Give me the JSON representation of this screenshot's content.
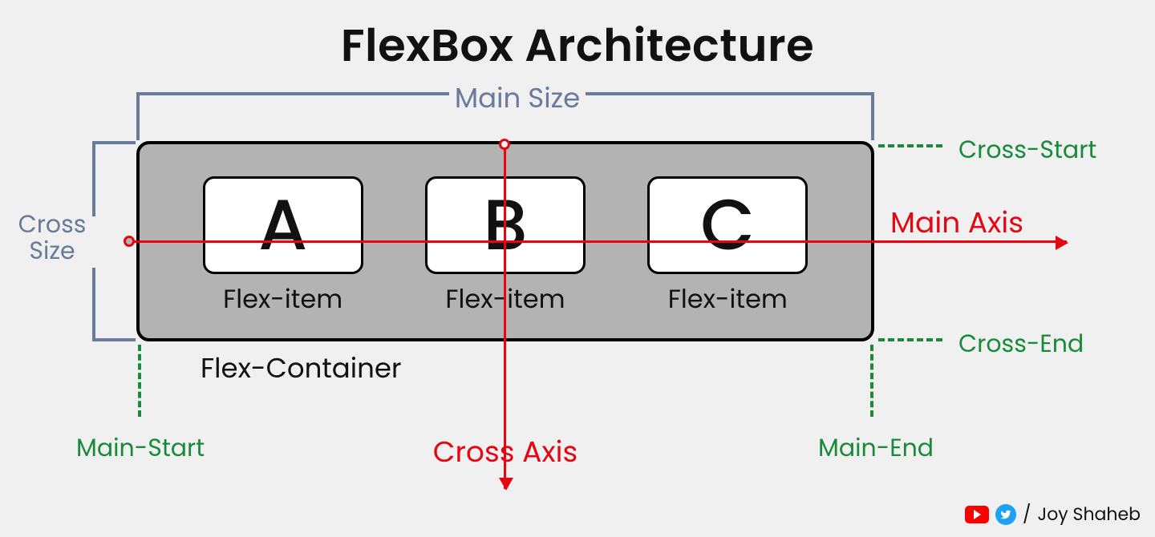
{
  "title": "FlexBox Architecture",
  "main_size_label": "Main Size",
  "cross_size_label": "Cross\nSize",
  "container_label": "Flex-Container",
  "items": [
    {
      "letter": "A",
      "caption": "Flex-item"
    },
    {
      "letter": "B",
      "caption": "Flex-item"
    },
    {
      "letter": "C",
      "caption": "Flex-item"
    }
  ],
  "axes": {
    "main": "Main Axis",
    "cross": "Cross Axis"
  },
  "markers": {
    "cross_start": "Cross-Start",
    "cross_end": "Cross-End",
    "main_start": "Main-Start",
    "main_end": "Main-End"
  },
  "credit": {
    "sep": "/",
    "name": "Joy Shaheb"
  },
  "colors": {
    "accent_red": "#e40613",
    "accent_green": "#188a3a",
    "accent_gray": "#6a7a9a",
    "container_bg": "#b3b3b3"
  }
}
